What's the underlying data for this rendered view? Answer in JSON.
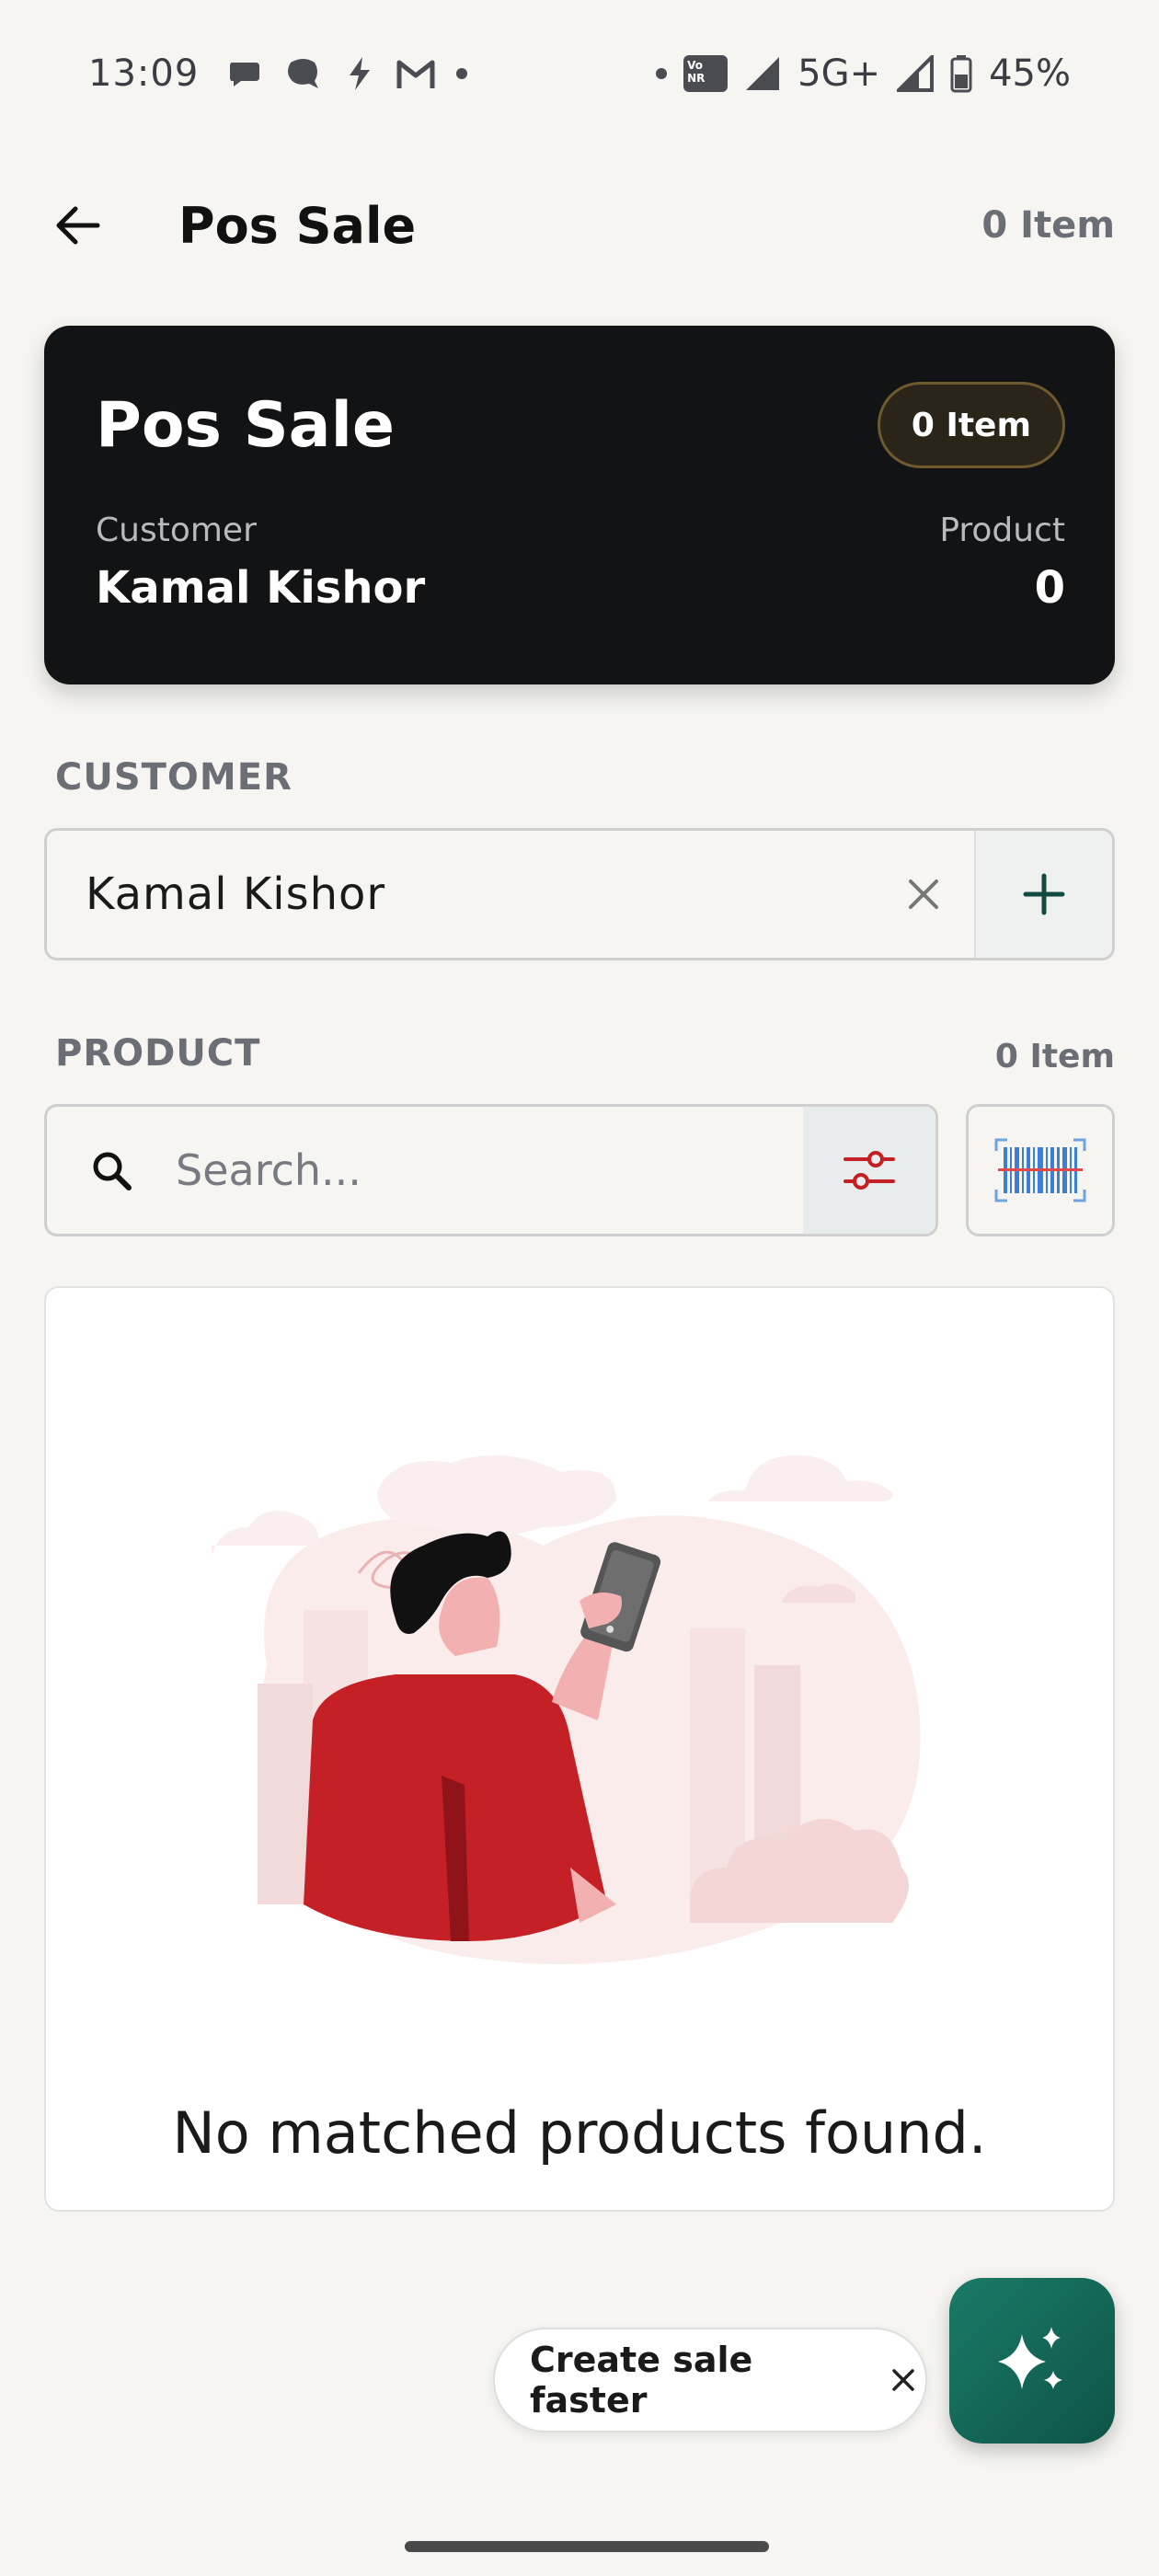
{
  "status_bar": {
    "time": "13:09",
    "network": "5G+",
    "battery": "45%",
    "volte_label": "Vo\nNR"
  },
  "app_bar": {
    "title": "Pos Sale",
    "item_count": "0 Item"
  },
  "summary": {
    "title": "Pos Sale",
    "item_badge": "0 Item",
    "customer_label": "Customer",
    "customer_value": "Kamal Kishor",
    "product_label": "Product",
    "product_value": "0"
  },
  "customer_section": {
    "label": "CUSTOMER",
    "selected": "Kamal Kishor"
  },
  "product_section": {
    "label": "PRODUCT",
    "item_count": "0 Item",
    "search_placeholder": "Search..."
  },
  "empty_state": {
    "message": "No matched products found."
  },
  "toast": {
    "label": "Create sale faster"
  },
  "colors": {
    "background": "#f6f5f2",
    "card_dark": "#121315",
    "accent_teal": "#0e5446",
    "accent_red": "#c62027"
  },
  "icons": {
    "back": "arrow-left-icon",
    "clear": "close-icon",
    "add": "plus-icon",
    "search": "search-icon",
    "filter": "sliders-icon",
    "barcode": "barcode-scan-icon",
    "fab": "sparkle-icon"
  }
}
